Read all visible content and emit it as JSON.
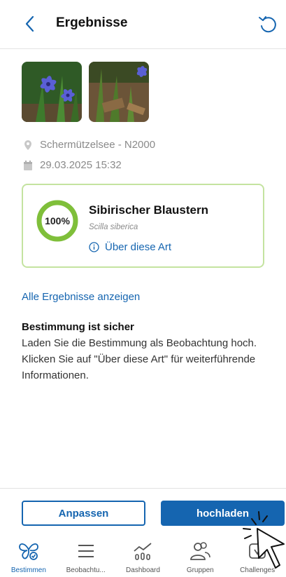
{
  "header": {
    "title": "Ergebnisse"
  },
  "observation": {
    "location": "Schermützelsee - N2000",
    "datetime": "29.03.2025 15:32"
  },
  "result": {
    "confidence": "100%",
    "confidence_value": 100,
    "species_name": "Sibirischer Blaustern",
    "latin_name": "Scilla siberica",
    "about_label": "Über diese Art"
  },
  "links": {
    "all_results": "Alle Ergebnisse anzeigen"
  },
  "info": {
    "title": "Bestimmung ist sicher",
    "text": "Laden Sie die Bestimmung als Beobachtung hoch. Klicken Sie auf \"Über diese Art\" für weiterführende Informationen."
  },
  "actions": {
    "adjust_label": "Anpassen",
    "upload_label": "hochladen"
  },
  "nav": {
    "items": [
      {
        "label": "Bestimmen",
        "icon": "butterfly-icon",
        "active": true
      },
      {
        "label": "Beobachtu...",
        "icon": "list-icon"
      },
      {
        "label": "Dashboard",
        "icon": "dashboard-icon"
      },
      {
        "label": "Gruppen",
        "icon": "groups-icon"
      },
      {
        "label": "Challenges",
        "icon": "challenges-icon"
      }
    ]
  },
  "colors": {
    "accent": "#1565b0",
    "ring": "#7fbf3a",
    "card_border": "#c4e3a0"
  }
}
